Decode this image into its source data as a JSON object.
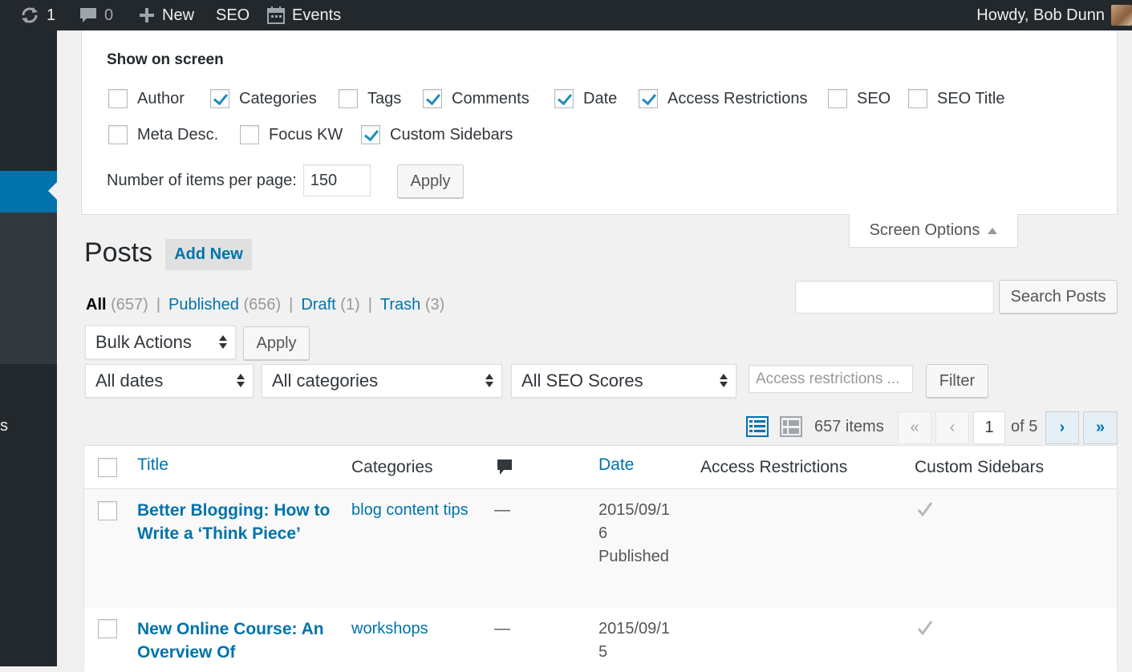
{
  "adminbar": {
    "updates_count": "1",
    "comments_count": "0",
    "new_label": "New",
    "seo_label": "SEO",
    "events_label": "Events",
    "greeting": "Howdy, Bob Dunn",
    "icons": [
      "refresh-icon",
      "comment-bubble-icon",
      "plus-icon",
      "calendar-icon",
      "avatar"
    ]
  },
  "sidebar": {
    "partial_label": "s"
  },
  "screen_options": {
    "title": "Show on screen",
    "columns": [
      {
        "label": "Author",
        "checked": false
      },
      {
        "label": "Categories",
        "checked": true
      },
      {
        "label": "Tags",
        "checked": false
      },
      {
        "label": "Comments",
        "checked": true
      },
      {
        "label": "Date",
        "checked": true
      },
      {
        "label": "Access Restrictions",
        "checked": true
      },
      {
        "label": "SEO",
        "checked": false
      },
      {
        "label": "SEO Title",
        "checked": false
      },
      {
        "label": "Meta Desc.",
        "checked": false
      },
      {
        "label": "Focus KW",
        "checked": false
      },
      {
        "label": "Custom Sidebars",
        "checked": true
      }
    ],
    "per_page_label": "Number of items per page:",
    "per_page_value": "150",
    "apply_label": "Apply",
    "tab_label": "Screen Options"
  },
  "heading": {
    "title": "Posts",
    "add_new": "Add New"
  },
  "status_links": [
    {
      "label": "All",
      "count": "(657)",
      "current": true
    },
    {
      "label": "Published",
      "count": "(656)",
      "current": false
    },
    {
      "label": "Draft",
      "count": "(1)",
      "current": false
    },
    {
      "label": "Trash",
      "count": "(3)",
      "current": false
    }
  ],
  "search": {
    "value": "",
    "button": "Search Posts"
  },
  "bulk": {
    "selected": "Bulk Actions",
    "apply": "Apply"
  },
  "filters": {
    "dates": "All dates",
    "categories": "All categories",
    "seo": "All SEO Scores",
    "access_placeholder": "Access restrictions ...",
    "filter_button": "Filter"
  },
  "pagination": {
    "items": "657 items",
    "first": "«",
    "prev": "‹",
    "current_page": "1",
    "of": "of 5",
    "next": "›",
    "last": "»"
  },
  "table": {
    "headers": {
      "title": "Title",
      "categories": "Categories",
      "date": "Date",
      "access": "Access Restrictions",
      "sidebars": "Custom Sidebars"
    },
    "rows": [
      {
        "title": "Better Blogging: How to Write a ‘Think Piece’",
        "categories": "blog content tips",
        "comments": "—",
        "date": "2015/09/16",
        "status": "Published",
        "sidebars": true
      },
      {
        "title": "New Online Course: An Overview Of",
        "categories": "workshops",
        "comments": "—",
        "date": "2015/09/15",
        "status": "",
        "sidebars": true
      }
    ]
  },
  "colors": {
    "accent": "#0073aa",
    "adminbar": "#23282d",
    "check": "#1e8cbe"
  }
}
